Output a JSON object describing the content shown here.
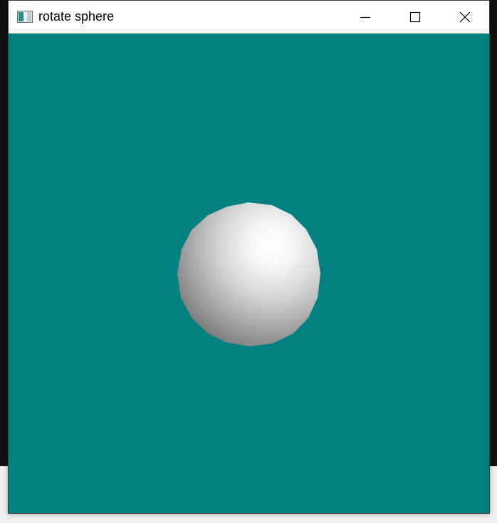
{
  "window": {
    "title": "rotate sphere",
    "app_icon": "opengl-window-icon",
    "controls": [
      {
        "name": "minimize",
        "icon": "minimize-icon"
      },
      {
        "name": "maximize",
        "icon": "maximize-icon"
      },
      {
        "name": "close",
        "icon": "close-icon"
      }
    ]
  },
  "canvas": {
    "background_color": "#008080",
    "object": "sphere",
    "object_color": "#f2f2f2"
  }
}
